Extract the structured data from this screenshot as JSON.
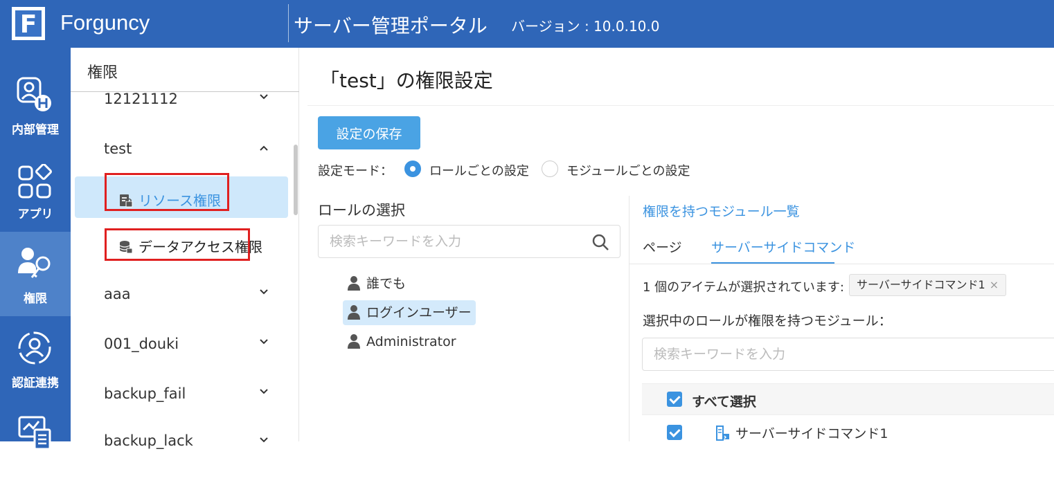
{
  "app": {
    "brand": "Forguncy",
    "portal_title": "サーバー管理ポータル",
    "version": "バージョン : 10.0.10.0"
  },
  "leftnav": {
    "items": [
      {
        "label": "内部管理",
        "icon": "internal-admin-icon",
        "active": false
      },
      {
        "label": "アプリ",
        "icon": "apps-icon",
        "active": false
      },
      {
        "label": "権限",
        "icon": "permission-key-icon",
        "active": true
      },
      {
        "label": "認証連携",
        "icon": "auth-link-icon",
        "active": false
      },
      {
        "label": "",
        "icon": "monitor-report-icon",
        "active": false
      }
    ]
  },
  "tree": {
    "title": "権限",
    "apps": [
      {
        "name": "12121112",
        "expanded": false
      },
      {
        "name": "test",
        "expanded": true
      },
      {
        "name": "aaa",
        "expanded": false
      },
      {
        "name": "001_douki",
        "expanded": false
      },
      {
        "name": "backup_fail",
        "expanded": false
      },
      {
        "name": "backup_lack",
        "expanded": false
      }
    ],
    "sub_items": [
      {
        "label": "リソース権限",
        "icon": "resource-lock-icon",
        "selected": true
      },
      {
        "label": "データアクセス権限",
        "icon": "database-lock-icon",
        "selected": false
      }
    ]
  },
  "main": {
    "title": "「test」の権限設定",
    "save_button": "設定の保存",
    "mode_label": "設定モード：",
    "mode_options": [
      {
        "label": "ロールごとの設定",
        "checked": true
      },
      {
        "label": "モジュールごとの設定",
        "checked": false
      }
    ],
    "role_section": {
      "title": "ロールの選択",
      "search_placeholder": "検索キーワードを入力",
      "roles": [
        {
          "label": "誰でも",
          "selected": false
        },
        {
          "label": "ログインユーザー",
          "selected": true
        },
        {
          "label": "Administrator",
          "selected": false
        }
      ]
    },
    "module_section": {
      "title": "権限を持つモジュール一覧",
      "tabs": [
        {
          "label": "ページ",
          "active": false
        },
        {
          "label": "サーバーサイドコマンド",
          "active": true
        }
      ],
      "selected_count_text": "1 個のアイテムが選択されています:",
      "selected_tag": "サーバーサイドコマンド1",
      "sub_label": "選択中のロールが権限を持つモジュール：",
      "search_placeholder": "検索キーワードを入力",
      "select_all": "すべて選択",
      "rows": [
        {
          "label": "サーバーサイドコマンド1",
          "checked": true
        }
      ]
    }
  },
  "colors": {
    "header": "#2f66b8",
    "nav_active": "#4e82c9",
    "accent": "#3b93e0",
    "highlight_box": "#e02020"
  }
}
